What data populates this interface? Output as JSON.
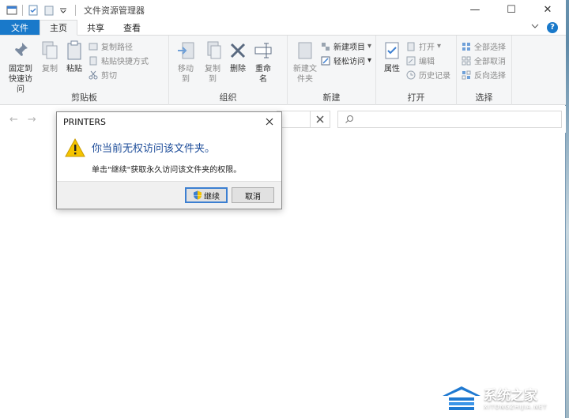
{
  "window": {
    "title": "文件资源管理器",
    "controls": {
      "minimize": "—",
      "maximize": "☐",
      "close": "✕"
    }
  },
  "tabs": {
    "file": "文件",
    "home": "主页",
    "share": "共享",
    "view": "查看"
  },
  "ribbon": {
    "clipboard": {
      "label": "剪贴板",
      "pin": "固定到快速访问",
      "copy": "复制",
      "paste": "粘贴",
      "copy_path": "复制路径",
      "paste_shortcut": "粘贴快捷方式",
      "cut": "剪切"
    },
    "organize": {
      "label": "组织",
      "move_to": "移动到",
      "copy_to": "复制到",
      "delete": "删除",
      "rename": "重命名"
    },
    "new": {
      "label": "新建",
      "new_folder": "新建文件夹",
      "new_item": "新建项目",
      "easy_access": "轻松访问"
    },
    "open": {
      "label": "打开",
      "properties": "属性",
      "open": "打开",
      "edit": "编辑",
      "history": "历史记录"
    },
    "select": {
      "label": "选择",
      "select_all": "全部选择",
      "select_none": "全部取消",
      "invert": "反向选择"
    }
  },
  "nav": {
    "back": "←",
    "forward": "→"
  },
  "dialog": {
    "title": "PRINTERS",
    "main_text": "你当前无权访问该文件夹。",
    "sub_text": "单击\"继续\"获取永久访问该文件夹的权限。",
    "continue_label": "继续",
    "cancel_label": "取消"
  },
  "watermark": {
    "name": "系统之家",
    "url": "XITONGZHIJIA.NET"
  },
  "colors": {
    "accent": "#1979ca",
    "dialog_heading": "#1f4e9a",
    "warning": "#f5c400"
  }
}
